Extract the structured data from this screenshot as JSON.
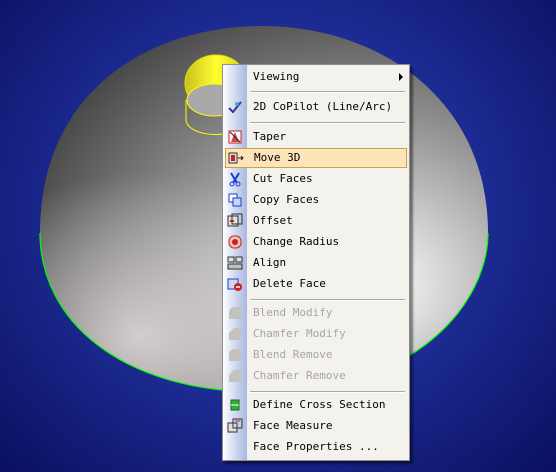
{
  "context_menu": {
    "items": [
      {
        "label": "Viewing",
        "icon": "none",
        "submenu": true
      },
      {
        "label": "2D CoPilot (Line/Arc)",
        "icon": "checkmark-icon"
      },
      {
        "label": "Taper",
        "icon": "taper-icon"
      },
      {
        "label": "Move 3D",
        "icon": "move-3d-icon",
        "highlighted": true
      },
      {
        "label": "Cut Faces",
        "icon": "cut-faces-icon"
      },
      {
        "label": "Copy Faces",
        "icon": "copy-faces-icon"
      },
      {
        "label": "Offset",
        "icon": "offset-icon"
      },
      {
        "label": "Change Radius",
        "icon": "change-radius-icon"
      },
      {
        "label": "Align",
        "icon": "align-icon"
      },
      {
        "label": "Delete Face",
        "icon": "delete-face-icon"
      },
      {
        "label": "Blend Modify",
        "icon": "blend-modify-icon",
        "disabled": true
      },
      {
        "label": "Chamfer Modify",
        "icon": "chamfer-modify-icon",
        "disabled": true
      },
      {
        "label": "Blend Remove",
        "icon": "blend-remove-icon",
        "disabled": true
      },
      {
        "label": "Chamfer Remove",
        "icon": "chamfer-remove-icon",
        "disabled": true
      },
      {
        "label": "Define Cross Section",
        "icon": "define-cross-section-icon"
      },
      {
        "label": "Face Measure",
        "icon": "face-measure-icon"
      },
      {
        "label": "Face Properties ...",
        "icon": "none"
      }
    ]
  },
  "colors": {
    "background": "#1f2f9a",
    "selection_edge": "#00ff00",
    "selected_face": "#ffff00",
    "menu_highlight": "#fce6b9"
  }
}
